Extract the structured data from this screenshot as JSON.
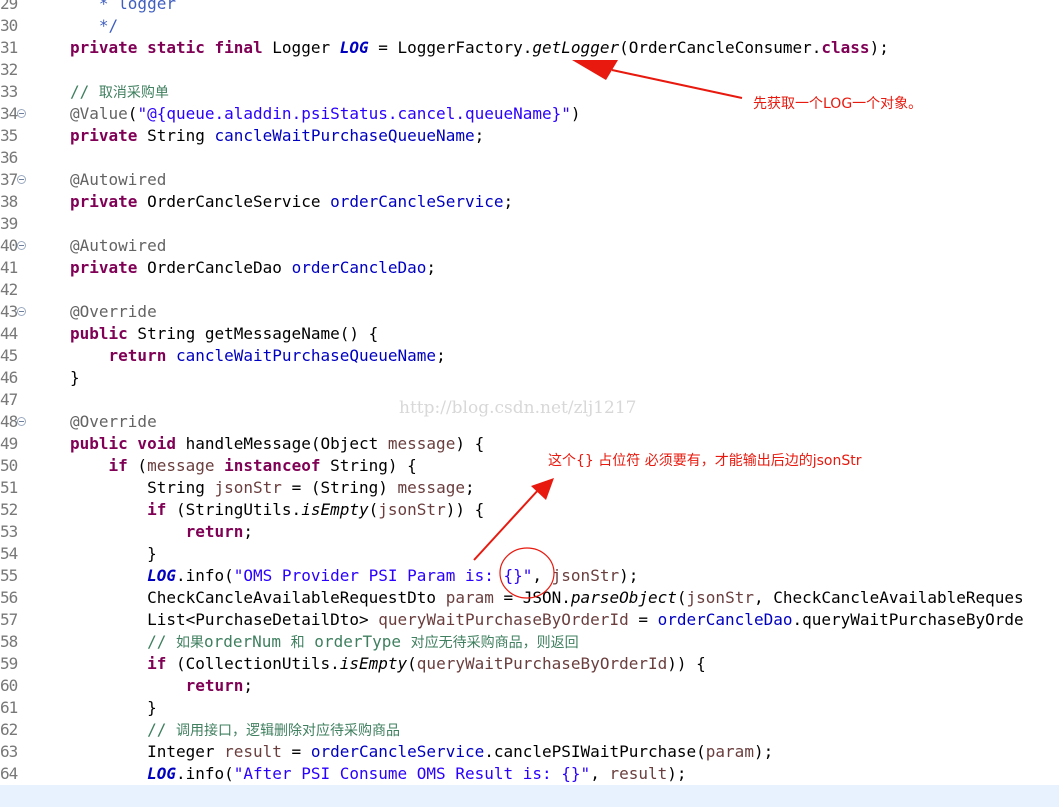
{
  "lines": [
    {
      "n": "29",
      "fold": false,
      "tokens": [
        {
          "t": "   * logger",
          "c": "doc"
        }
      ]
    },
    {
      "n": "30",
      "fold": false,
      "tokens": [
        {
          "t": "   */",
          "c": "doc"
        }
      ]
    },
    {
      "n": "31",
      "fold": false,
      "tokens": [
        {
          "t": "private static final",
          "c": "k"
        },
        {
          "t": " Logger "
        },
        {
          "t": "LOG",
          "c": "sf"
        },
        {
          "t": " = LoggerFactory."
        },
        {
          "t": "getLogger",
          "c": "i"
        },
        {
          "t": "(OrderCancleConsumer."
        },
        {
          "t": "class",
          "c": "k"
        },
        {
          "t": ");"
        }
      ]
    },
    {
      "n": "32",
      "fold": false,
      "tokens": []
    },
    {
      "n": "33",
      "fold": false,
      "tokens": [
        {
          "t": "// ",
          "c": "c"
        },
        {
          "t": "取消采购单",
          "c": "c cjk"
        }
      ]
    },
    {
      "n": "34",
      "fold": true,
      "tokens": [
        {
          "t": "@Value",
          "c": "a"
        },
        {
          "t": "("
        },
        {
          "t": "\"@{queue.aladdin.psiStatus.cancel.queueName}\"",
          "c": "s"
        },
        {
          "t": ")"
        }
      ]
    },
    {
      "n": "35",
      "fold": false,
      "tokens": [
        {
          "t": "private",
          "c": "k"
        },
        {
          "t": " String "
        },
        {
          "t": "cancleWaitPurchaseQueueName",
          "c": "f"
        },
        {
          "t": ";"
        }
      ]
    },
    {
      "n": "36",
      "fold": false,
      "tokens": []
    },
    {
      "n": "37",
      "fold": true,
      "tokens": [
        {
          "t": "@Autowired",
          "c": "a"
        }
      ]
    },
    {
      "n": "38",
      "fold": false,
      "tokens": [
        {
          "t": "private",
          "c": "k"
        },
        {
          "t": " OrderCancleService "
        },
        {
          "t": "orderCancleService",
          "c": "f"
        },
        {
          "t": ";"
        }
      ]
    },
    {
      "n": "39",
      "fold": false,
      "tokens": []
    },
    {
      "n": "40",
      "fold": true,
      "tokens": [
        {
          "t": "@Autowired",
          "c": "a"
        }
      ]
    },
    {
      "n": "41",
      "fold": false,
      "tokens": [
        {
          "t": "private",
          "c": "k"
        },
        {
          "t": " OrderCancleDao "
        },
        {
          "t": "orderCancleDao",
          "c": "f"
        },
        {
          "t": ";"
        }
      ]
    },
    {
      "n": "42",
      "fold": false,
      "tokens": []
    },
    {
      "n": "43",
      "fold": true,
      "tokens": [
        {
          "t": "@Override",
          "c": "a"
        }
      ]
    },
    {
      "n": "44",
      "fold": false,
      "tokens": [
        {
          "t": "public",
          "c": "k"
        },
        {
          "t": " String getMessageName() {"
        }
      ]
    },
    {
      "n": "45",
      "fold": false,
      "tokens": [
        {
          "t": "    "
        },
        {
          "t": "return",
          "c": "k"
        },
        {
          "t": " "
        },
        {
          "t": "cancleWaitPurchaseQueueName",
          "c": "f"
        },
        {
          "t": ";"
        }
      ]
    },
    {
      "n": "46",
      "fold": false,
      "tokens": [
        {
          "t": "}"
        }
      ]
    },
    {
      "n": "47",
      "fold": false,
      "tokens": []
    },
    {
      "n": "48",
      "fold": true,
      "tokens": [
        {
          "t": "@Override",
          "c": "a"
        }
      ]
    },
    {
      "n": "49",
      "fold": false,
      "tokens": [
        {
          "t": "public void",
          "c": "k"
        },
        {
          "t": " handleMessage(Object "
        },
        {
          "t": "message",
          "c": "v"
        },
        {
          "t": ") {"
        }
      ]
    },
    {
      "n": "50",
      "fold": false,
      "tokens": [
        {
          "t": "    "
        },
        {
          "t": "if",
          "c": "k"
        },
        {
          "t": " ("
        },
        {
          "t": "message",
          "c": "v"
        },
        {
          "t": " "
        },
        {
          "t": "instanceof",
          "c": "k"
        },
        {
          "t": " String) {"
        }
      ]
    },
    {
      "n": "51",
      "fold": false,
      "tokens": [
        {
          "t": "        String "
        },
        {
          "t": "jsonStr",
          "c": "v"
        },
        {
          "t": " = (String) "
        },
        {
          "t": "message",
          "c": "v"
        },
        {
          "t": ";"
        }
      ]
    },
    {
      "n": "52",
      "fold": false,
      "tokens": [
        {
          "t": "        "
        },
        {
          "t": "if",
          "c": "k"
        },
        {
          "t": " (StringUtils."
        },
        {
          "t": "isEmpty",
          "c": "i"
        },
        {
          "t": "("
        },
        {
          "t": "jsonStr",
          "c": "v"
        },
        {
          "t": ")) {"
        }
      ]
    },
    {
      "n": "53",
      "fold": false,
      "tokens": [
        {
          "t": "            "
        },
        {
          "t": "return",
          "c": "k"
        },
        {
          "t": ";"
        }
      ]
    },
    {
      "n": "54",
      "fold": false,
      "tokens": [
        {
          "t": "        }"
        }
      ]
    },
    {
      "n": "55",
      "fold": false,
      "tokens": [
        {
          "t": "        "
        },
        {
          "t": "LOG",
          "c": "sf"
        },
        {
          "t": ".info("
        },
        {
          "t": "\"OMS Provider PSI Param is: {}\"",
          "c": "s"
        },
        {
          "t": ", "
        },
        {
          "t": "jsonStr",
          "c": "v"
        },
        {
          "t": ");"
        }
      ]
    },
    {
      "n": "56",
      "fold": false,
      "tokens": [
        {
          "t": "        CheckCancleAvailableRequestDto "
        },
        {
          "t": "param",
          "c": "v"
        },
        {
          "t": " = JSON."
        },
        {
          "t": "parseObject",
          "c": "i"
        },
        {
          "t": "("
        },
        {
          "t": "jsonStr",
          "c": "v"
        },
        {
          "t": ", CheckCancleAvailableReques"
        }
      ]
    },
    {
      "n": "57",
      "fold": false,
      "tokens": [
        {
          "t": "        List<PurchaseDetailDto> "
        },
        {
          "t": "queryWaitPurchaseByOrderId",
          "c": "v"
        },
        {
          "t": " = "
        },
        {
          "t": "orderCancleDao",
          "c": "f"
        },
        {
          "t": ".queryWaitPurchaseByOrde"
        }
      ]
    },
    {
      "n": "58",
      "fold": false,
      "tokens": [
        {
          "t": "        // ",
          "c": "c"
        },
        {
          "t": "如果",
          "c": "c cjk"
        },
        {
          "t": "orderNum ",
          "c": "c"
        },
        {
          "t": "和",
          "c": "c cjk"
        },
        {
          "t": " orderType ",
          "c": "c"
        },
        {
          "t": "对应无待采购商品，则返回",
          "c": "c cjk"
        }
      ]
    },
    {
      "n": "59",
      "fold": false,
      "tokens": [
        {
          "t": "        "
        },
        {
          "t": "if",
          "c": "k"
        },
        {
          "t": " (CollectionUtils."
        },
        {
          "t": "isEmpty",
          "c": "i"
        },
        {
          "t": "("
        },
        {
          "t": "queryWaitPurchaseByOrderId",
          "c": "v"
        },
        {
          "t": ")) {"
        }
      ]
    },
    {
      "n": "60",
      "fold": false,
      "tokens": [
        {
          "t": "            "
        },
        {
          "t": "return",
          "c": "k"
        },
        {
          "t": ";"
        }
      ]
    },
    {
      "n": "61",
      "fold": false,
      "tokens": [
        {
          "t": "        }"
        }
      ]
    },
    {
      "n": "62",
      "fold": false,
      "tokens": [
        {
          "t": "        // ",
          "c": "c"
        },
        {
          "t": "调用接口，逻辑删除对应待采购商品",
          "c": "c cjk"
        }
      ]
    },
    {
      "n": "63",
      "fold": false,
      "tokens": [
        {
          "t": "        Integer "
        },
        {
          "t": "result",
          "c": "v"
        },
        {
          "t": " = "
        },
        {
          "t": "orderCancleService",
          "c": "f"
        },
        {
          "t": ".canclePSIWaitPurchase("
        },
        {
          "t": "param",
          "c": "v"
        },
        {
          "t": ");"
        }
      ]
    },
    {
      "n": "64",
      "fold": false,
      "tokens": [
        {
          "t": "        "
        },
        {
          "t": "LOG",
          "c": "sf"
        },
        {
          "t": ".info("
        },
        {
          "t": "\"After PSI Consume OMS Result is: {}\"",
          "c": "s"
        },
        {
          "t": ", "
        },
        {
          "t": "result",
          "c": "v"
        },
        {
          "t": ");"
        }
      ]
    }
  ],
  "watermark": "http://blog.csdn.net/zlj1217",
  "annotations": {
    "note1": "先获取一个LOG一个对象。",
    "note2": "这个{} 占位符 必须要有，才能输出后边的jsonStr",
    "color": "#e8190e"
  }
}
